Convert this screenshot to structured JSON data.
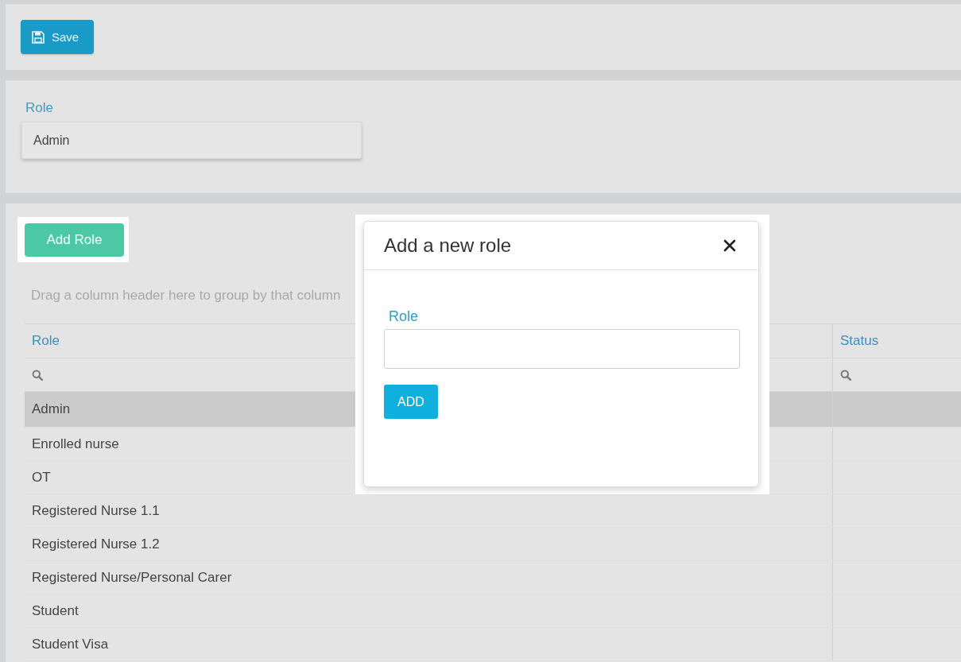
{
  "toolbar": {
    "save_button": "Save"
  },
  "role_form": {
    "label": "Role",
    "value": "Admin"
  },
  "grid": {
    "add_button": "Add Role",
    "group_hint": "Drag a column header here to group by that column",
    "columns": [
      {
        "label": "Role"
      },
      {
        "label": "Status"
      }
    ],
    "rows": [
      {
        "role": "Admin",
        "selected": true
      },
      {
        "role": "Enrolled nurse",
        "selected": false
      },
      {
        "role": "OT",
        "selected": false
      },
      {
        "role": "Registered Nurse 1.1",
        "selected": false
      },
      {
        "role": "Registered Nurse 1.2",
        "selected": false
      },
      {
        "role": "Registered Nurse/Personal Carer",
        "selected": false
      },
      {
        "role": "Student",
        "selected": false
      },
      {
        "role": "Student Visa",
        "selected": false
      }
    ]
  },
  "dialog": {
    "title": "Add a new role",
    "field_label": "Role",
    "button": "ADD"
  }
}
